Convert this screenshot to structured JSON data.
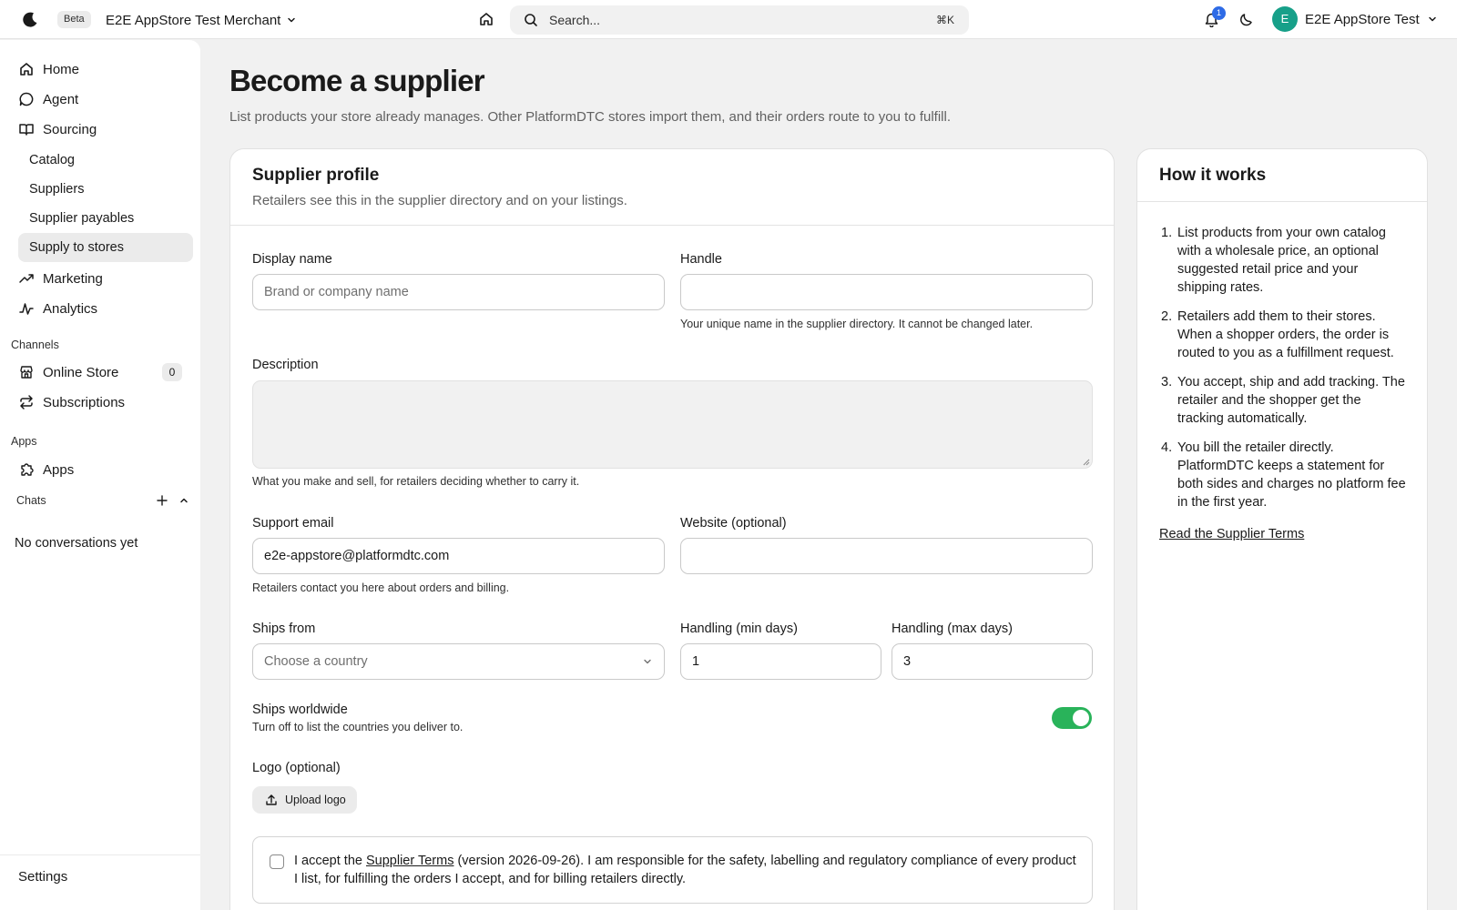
{
  "topbar": {
    "beta": "Beta",
    "store_name": "E2E AppStore Test Merchant",
    "search_placeholder": "Search...",
    "search_shortcut": "⌘K",
    "notifications_count": "1",
    "avatar_initial": "E",
    "user_name": "E2E AppStore Test"
  },
  "sidebar": {
    "nav": [
      {
        "label": "Home",
        "icon": "home-icon"
      },
      {
        "label": "Agent",
        "icon": "chat-bubble-icon"
      },
      {
        "label": "Sourcing",
        "icon": "book-icon"
      }
    ],
    "sourcing_sub": [
      {
        "label": "Catalog"
      },
      {
        "label": "Suppliers"
      },
      {
        "label": "Supplier payables"
      },
      {
        "label": "Supply to stores",
        "active": true
      }
    ],
    "nav2": [
      {
        "label": "Marketing",
        "icon": "trend-up-icon"
      },
      {
        "label": "Analytics",
        "icon": "activity-icon"
      }
    ],
    "channels_label": "Channels",
    "channels": [
      {
        "label": "Online Store",
        "icon": "store-icon",
        "count": "0"
      },
      {
        "label": "Subscriptions",
        "icon": "repeat-icon"
      }
    ],
    "apps_label": "Apps",
    "apps": [
      {
        "label": "Apps",
        "icon": "puzzle-icon"
      }
    ],
    "chats_label": "Chats",
    "chats_empty": "No conversations yet",
    "settings": "Settings"
  },
  "page": {
    "title": "Become a supplier",
    "subtitle": "List products your store already manages. Other PlatformDTC stores import them, and their orders route to you to fulfill."
  },
  "profile": {
    "title": "Supplier profile",
    "subtitle": "Retailers see this in the supplier directory and on your listings.",
    "display_name": {
      "label": "Display name",
      "value": "",
      "placeholder": "Brand or company name"
    },
    "handle": {
      "label": "Handle",
      "value": "",
      "help": "Your unique name in the supplier directory. It cannot be changed later."
    },
    "description": {
      "label": "Description",
      "value": "",
      "help": "What you make and sell, for retailers deciding whether to carry it."
    },
    "support_email": {
      "label": "Support email",
      "value": "e2e-appstore@platformdtc.com",
      "help": "Retailers contact you here about orders and billing."
    },
    "website": {
      "label": "Website (optional)",
      "value": ""
    },
    "ships_from": {
      "label": "Ships from",
      "placeholder": "Choose a country"
    },
    "handling_min": {
      "label": "Handling (min days)",
      "value": "1"
    },
    "handling_max": {
      "label": "Handling (max days)",
      "value": "3"
    },
    "ships_worldwide": {
      "label": "Ships worldwide",
      "help": "Turn off to list the countries you deliver to.",
      "on": true
    },
    "logo": {
      "label": "Logo (optional)",
      "button": "Upload logo"
    },
    "terms": {
      "prefix": "I accept the ",
      "link": "Supplier Terms",
      "suffix": " (version 2026-09-26). I am responsible for the safety, labelling and regulatory compliance of every product I list, for fulfilling the orders I accept, and for billing retailers directly.",
      "checked": false
    }
  },
  "how_it_works": {
    "title": "How it works",
    "steps": [
      "List products from your own catalog with a wholesale price, an optional suggested retail price and your shipping rates.",
      "Retailers add them to their stores. When a shopper orders, the order is routed to you as a fulfillment request.",
      "You accept, ship and add tracking. The retailer and the shopper get the tracking automatically.",
      "You bill the retailer directly. PlatformDTC keeps a statement for both sides and charges no platform fee in the first year."
    ],
    "link": "Read the Supplier Terms"
  },
  "colors": {
    "accent_toggle": "#29b35a",
    "avatar": "#17a089",
    "badge": "#2e6be6"
  }
}
